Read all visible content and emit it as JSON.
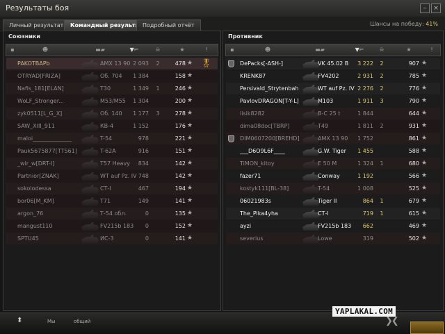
{
  "window": {
    "title": "Результаты боя"
  },
  "tabs": [
    {
      "label": "Личный результат"
    },
    {
      "label": "Командный результат",
      "active": true
    },
    {
      "label": "Подробный отчёт"
    }
  ],
  "win_chance": {
    "label": "Шансы на победу:",
    "value": "41%"
  },
  "allies": {
    "title": "Союзники",
    "players": [
      {
        "name": "PAKOTBAPb",
        "vehicle": "AMX 13 90",
        "damage": "2 093",
        "kills": "2",
        "xp": "478",
        "medal": "🎖",
        "highlight": true,
        "dead": true
      },
      {
        "name": "OTRYAD[FRIZA]",
        "vehicle": "Об. 704",
        "damage": "1 384",
        "kills": "",
        "xp": "158",
        "dead": true
      },
      {
        "name": "Nafis_181[ELAN]",
        "vehicle": "T30",
        "damage": "1 349",
        "kills": "1",
        "xp": "246",
        "dead": true
      },
      {
        "name": "WoLF_Stronger...",
        "vehicle": "M53/M55",
        "damage": "1 304",
        "kills": "",
        "xp": "200",
        "dead": true
      },
      {
        "name": "zyk0511[L_G_X]",
        "vehicle": "Об. 140",
        "damage": "1 177",
        "kills": "3",
        "xp": "278",
        "dead": true
      },
      {
        "name": "SAW_XIII_911",
        "vehicle": "КВ-4",
        "damage": "1 152",
        "kills": "",
        "xp": "176",
        "dead": true
      },
      {
        "name": "maloi______________",
        "vehicle": "T-54",
        "damage": "978",
        "kills": "",
        "xp": "221",
        "dead": true
      },
      {
        "name": "Pauk5675877[TTS61]",
        "vehicle": "T-62A",
        "damage": "916",
        "kills": "",
        "xp": "151",
        "dead": true
      },
      {
        "name": "_wir_w[DRT-I]",
        "vehicle": "T57 Heavy",
        "damage": "834",
        "kills": "",
        "xp": "142",
        "dead": true
      },
      {
        "name": "Partnior[ZNAK]",
        "vehicle": "WT auf Pz. IV",
        "damage": "748",
        "kills": "",
        "xp": "142",
        "dead": true
      },
      {
        "name": "sokolodessa",
        "vehicle": "СТ-I",
        "damage": "467",
        "kills": "",
        "xp": "194",
        "dead": true
      },
      {
        "name": "bor06[M_KM]",
        "vehicle": "T71",
        "damage": "149",
        "kills": "",
        "xp": "141",
        "dead": true
      },
      {
        "name": "argon_76",
        "vehicle": "Т-54 обл.",
        "damage": "0",
        "kills": "",
        "xp": "135",
        "dead": true
      },
      {
        "name": "mangust110",
        "vehicle": "FV215b 183",
        "damage": "0",
        "kills": "",
        "xp": "152",
        "dead": true
      },
      {
        "name": "SPTU45",
        "vehicle": "ИС-3",
        "damage": "0",
        "kills": "",
        "xp": "141",
        "dead": true
      }
    ]
  },
  "enemies": {
    "title": "Противник",
    "players": [
      {
        "name": "DePacks[-ASH-]",
        "vehicle": "VK 45.02 B",
        "damage": "3 222",
        "kills": "2",
        "xp": "907",
        "platoon": true,
        "dead": false
      },
      {
        "name": "KRENK87",
        "vehicle": "FV4202",
        "damage": "2 931",
        "kills": "2",
        "xp": "785",
        "dead": false
      },
      {
        "name": "Persivald_Strytenbah",
        "vehicle": "WT auf Pz. IV",
        "damage": "2 276",
        "kills": "2",
        "xp": "776",
        "dead": false
      },
      {
        "name": "PavlovDRAGON[T-Y-L]",
        "vehicle": "M103",
        "damage": "1 911",
        "kills": "3",
        "xp": "790",
        "dead": false
      },
      {
        "name": "lisik8282",
        "vehicle": "B-C 25 t",
        "damage": "1 844",
        "kills": "",
        "xp": "644",
        "dead": true
      },
      {
        "name": "dima08doc[TBRP]",
        "vehicle": "T49",
        "damage": "1 811",
        "kills": "2",
        "xp": "931",
        "dead": true
      },
      {
        "name": "DIM0607200[BREHD]",
        "vehicle": "AMX 13 90",
        "damage": "1 752",
        "kills": "",
        "xp": "861",
        "platoon": true,
        "dead": true
      },
      {
        "name": "___D6O9L6F____",
        "vehicle": "G.W. Tiger",
        "damage": "1 455",
        "kills": "",
        "xp": "588",
        "dead": false
      },
      {
        "name": "TiMON_kitoy",
        "vehicle": "E 50 M",
        "damage": "1 324",
        "kills": "1",
        "xp": "680",
        "dead": true
      },
      {
        "name": "fazer71",
        "vehicle": "Conway",
        "damage": "1 192",
        "kills": "",
        "xp": "566",
        "dead": false
      },
      {
        "name": "kostyk111[BL-38]",
        "vehicle": "T-54",
        "damage": "1 008",
        "kills": "",
        "xp": "525",
        "dead": true
      },
      {
        "name": "06021983s",
        "vehicle": "Tiger II",
        "damage": "864",
        "kills": "1",
        "xp": "679",
        "dead": false
      },
      {
        "name": "The_Pika4yha",
        "vehicle": "СТ-I",
        "damage": "719",
        "kills": "1",
        "xp": "615",
        "dead": false
      },
      {
        "name": "ayzi",
        "vehicle": "FV215b 183",
        "damage": "662",
        "kills": "",
        "xp": "469",
        "dead": false
      },
      {
        "name": "severius",
        "vehicle": "Lowe",
        "damage": "319",
        "kills": "",
        "xp": "502",
        "dead": true
      }
    ]
  },
  "bottom": {
    "left_label": "Мы",
    "mid_label": "общий"
  },
  "watermark": "YAPLAKAL.COM",
  "colors": {
    "accent": "#e0c870",
    "dead_row": "#251c1c",
    "highlight_row": "#3a2c2c",
    "medal": "#d8a030"
  },
  "icons": [
    "minimize-icon",
    "close-icon",
    "player-icon",
    "vehicle-icon",
    "damage-icon",
    "kills-icon",
    "xp-star-icon",
    "medal-icon",
    "platoon-icon",
    "collapse-icon",
    "chevron-icon"
  ]
}
